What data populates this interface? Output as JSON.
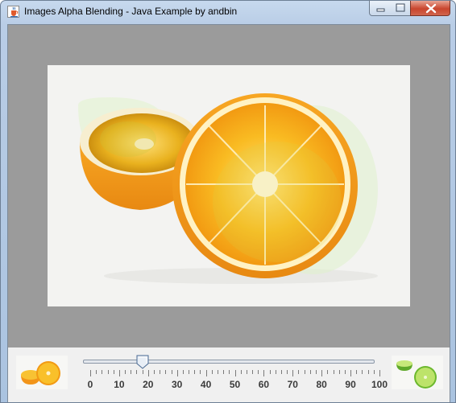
{
  "window": {
    "title": "Images Alpha Blending - Java Example by andbin",
    "controls": {
      "minimize_icon": "minimize-icon",
      "maximize_icon": "maximize-icon",
      "close_icon": "close-icon"
    }
  },
  "colors": {
    "client_background": "#9b9b9b",
    "bottom_panel": "#f0f0f0",
    "orange": "#f6a21a",
    "lime": "#8ccf3a"
  },
  "image_view": {
    "description_left_thumb": "orange",
    "description_right_thumb": "lime"
  },
  "slider": {
    "min": 0,
    "max": 100,
    "value": 18,
    "major_tick_labels": [
      "0",
      "10",
      "20",
      "30",
      "40",
      "50",
      "60",
      "70",
      "80",
      "90",
      "100"
    ]
  }
}
